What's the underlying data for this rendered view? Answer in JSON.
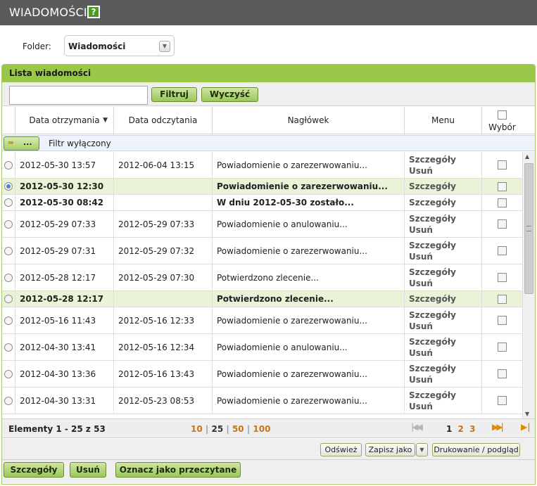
{
  "header": {
    "title": "WIADOMOŚCI",
    "help_icon": "help-icon",
    "help_label": "?"
  },
  "folder": {
    "label": "Folder:",
    "value": "Wiadomości"
  },
  "panel": {
    "title": "Lista wiadomości"
  },
  "toolbar": {
    "search_value": "",
    "filter_label": "Filtruj",
    "clear_label": "Wyczyść"
  },
  "columns": {
    "received": "Data otrzymania",
    "read": "Data odczytania",
    "subject": "Nagłówek",
    "menu": "Menu",
    "select": "Wybór"
  },
  "filter": {
    "button_label": "...",
    "icon": "arrows-icon",
    "icon_glyph": "⇛",
    "status": "Filtr wyłączony"
  },
  "rows": [
    {
      "received": "2012-05-30 13:57",
      "read": "2012-06-04 13:15",
      "subject": "Powiadomienie o zarezerwowaniu...",
      "details": "Szczegóły",
      "delete": "Usuń"
    },
    {
      "received": "2012-05-30 12:30",
      "read": "",
      "subject": "Powiadomienie o zarezerwowaniu...",
      "details": "Szczegóły",
      "delete": ""
    },
    {
      "received": "2012-05-30 08:42",
      "read": "",
      "subject": "W dniu 2012-05-30 zostało...",
      "details": "Szczegóły",
      "delete": ""
    },
    {
      "received": "2012-05-29 07:33",
      "read": "2012-05-29 07:33",
      "subject": "Powiadomienie o anulowaniu...",
      "details": "Szczegóły",
      "delete": "Usuń"
    },
    {
      "received": "2012-05-29 07:31",
      "read": "2012-05-29 07:32",
      "subject": "Powiadomienie o zarezerwowaniu...",
      "details": "Szczegóły",
      "delete": "Usuń"
    },
    {
      "received": "2012-05-28 12:17",
      "read": "2012-05-29 07:30",
      "subject": "Potwierdzono zlecenie...",
      "details": "Szczegóły",
      "delete": "Usuń"
    },
    {
      "received": "2012-05-28 12:17",
      "read": "",
      "subject": "Potwierdzono zlecenie...",
      "details": "Szczegóły",
      "delete": ""
    },
    {
      "received": "2012-05-16 11:43",
      "read": "2012-05-16 12:33",
      "subject": "Powiadomienie o zarezerwowaniu...",
      "details": "Szczegóły",
      "delete": "Usuń"
    },
    {
      "received": "2012-04-30 13:41",
      "read": "2012-05-16 12:34",
      "subject": "Powiadomienie o anulowaniu...",
      "details": "Szczegóły",
      "delete": "Usuń"
    },
    {
      "received": "2012-04-30 13:36",
      "read": "2012-05-16 13:43",
      "subject": "Powiadomienie o zarezerwowaniu...",
      "details": "Szczegóły",
      "delete": "Usuń"
    },
    {
      "received": "2012-04-30 13:31",
      "read": "2012-05-23 08:53",
      "subject": "Powiadomienie o zarezerwowaniu...",
      "details": "Szczegóły",
      "delete": "Usuń"
    }
  ],
  "pager": {
    "count_text": "Elementy 1 - 25 z 53",
    "page_sizes": [
      "10",
      "25",
      "50",
      "100"
    ],
    "page_size_separator": "|",
    "pages": [
      "1",
      "2",
      "3"
    ],
    "first_icon": "first-page-icon",
    "next_icon": "next-page-icon",
    "last_icon": "last-page-icon"
  },
  "actions": {
    "refresh": "Odśwież",
    "save_as": "Zapisz jako",
    "print": "Drukowanie / podgląd"
  },
  "bottom": {
    "details": "Szczegóły",
    "delete": "Usuń",
    "mark_read": "Oznacz jako przeczytane"
  },
  "colors": {
    "accent_green": "#9ac64a",
    "header_dark": "#5b5b5b",
    "highlight_row": "#e8f3d8",
    "link_orange": "#c8731a"
  }
}
